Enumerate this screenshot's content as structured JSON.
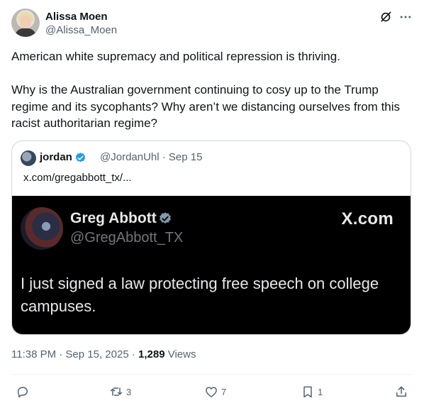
{
  "author": {
    "name": "Alissa Moen",
    "handle": "@Alissa_Moen"
  },
  "tweet": {
    "text": "American white supremacy and political repression is thriving.\n\nWhy is the Australian government continuing to cosy up to the Trump regime and its sycophants? Why aren’t we distancing ourselves from this racist authoritarian regime?"
  },
  "quote": {
    "name": "jordan",
    "handle": "@JordanUhl · Sep 15",
    "link": "x.com/gregabbott_tx/...",
    "card": {
      "name": "Greg Abbott",
      "handle": "@GregAbbott_TX",
      "brand": "X.com",
      "text": "I just signed a law protecting free speech on college campuses."
    }
  },
  "meta": {
    "time": "11:38 PM · Sep 15, 2025 · ",
    "views_count": "1,289",
    "views_label": "Views"
  },
  "actions": {
    "reply_count": "",
    "repost_count": "3",
    "like_count": "7",
    "bookmark_count": "1"
  },
  "icons": {
    "grok": "grok-icon",
    "more": "more-icon",
    "verified": "verified-icon",
    "reply": "reply-icon",
    "repost": "repost-icon",
    "like": "heart-icon",
    "bookmark": "bookmark-icon",
    "share": "share-icon"
  },
  "colors": {
    "verified": "#1d9bf0",
    "secondary_text": "#536471",
    "card_bg": "#000000"
  }
}
